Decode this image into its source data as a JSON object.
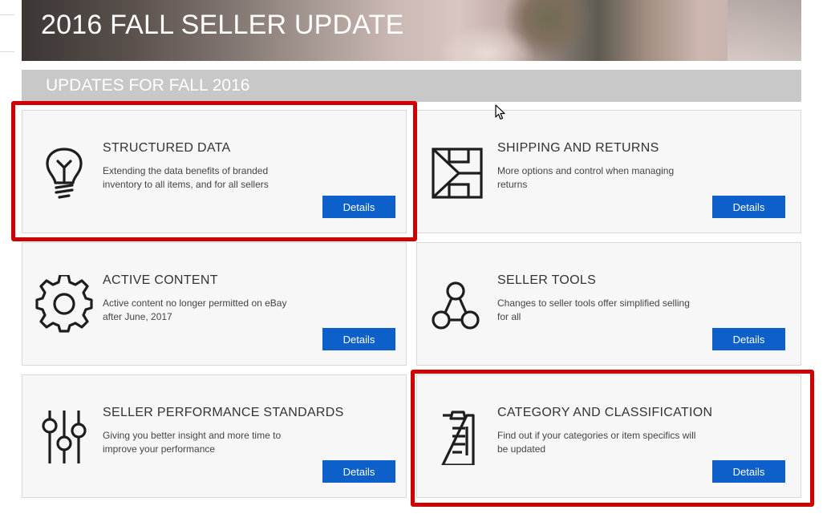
{
  "header": {
    "title": "2016 FALL SELLER UPDATE"
  },
  "section": {
    "title": "UPDATES FOR FALL 2016"
  },
  "cards": [
    {
      "title": "STRUCTURED DATA",
      "description": "Extending the data benefits of branded inventory to all items, and for all sellers",
      "button": "Details",
      "icon": "lightbulb-icon",
      "highlighted": true
    },
    {
      "title": "SHIPPING AND RETURNS",
      "description": "More options and control when managing returns",
      "button": "Details",
      "icon": "shipping-returns-icon",
      "highlighted": false
    },
    {
      "title": "ACTIVE CONTENT",
      "description": "Active content no longer permitted on eBay after June, 2017",
      "button": "Details",
      "icon": "gear-icon",
      "highlighted": false
    },
    {
      "title": "SELLER TOOLS",
      "description": "Changes to seller tools offer simplified selling for all",
      "button": "Details",
      "icon": "network-icon",
      "highlighted": false
    },
    {
      "title": "SELLER PERFORMANCE STANDARDS",
      "description": "Giving you better insight and more time to improve your performance",
      "button": "Details",
      "icon": "sliders-icon",
      "highlighted": false
    },
    {
      "title": "CATEGORY AND CLASSIFICATION",
      "description": "Find out if your categories or item specifics will be updated",
      "button": "Details",
      "icon": "clipboard-icon",
      "highlighted": true
    }
  ],
  "colors": {
    "button_blue": "#0d60c9",
    "highlight_red": "#d10000",
    "section_bar_gray": "#c8c8c8",
    "card_background": "#f7f7f7"
  }
}
